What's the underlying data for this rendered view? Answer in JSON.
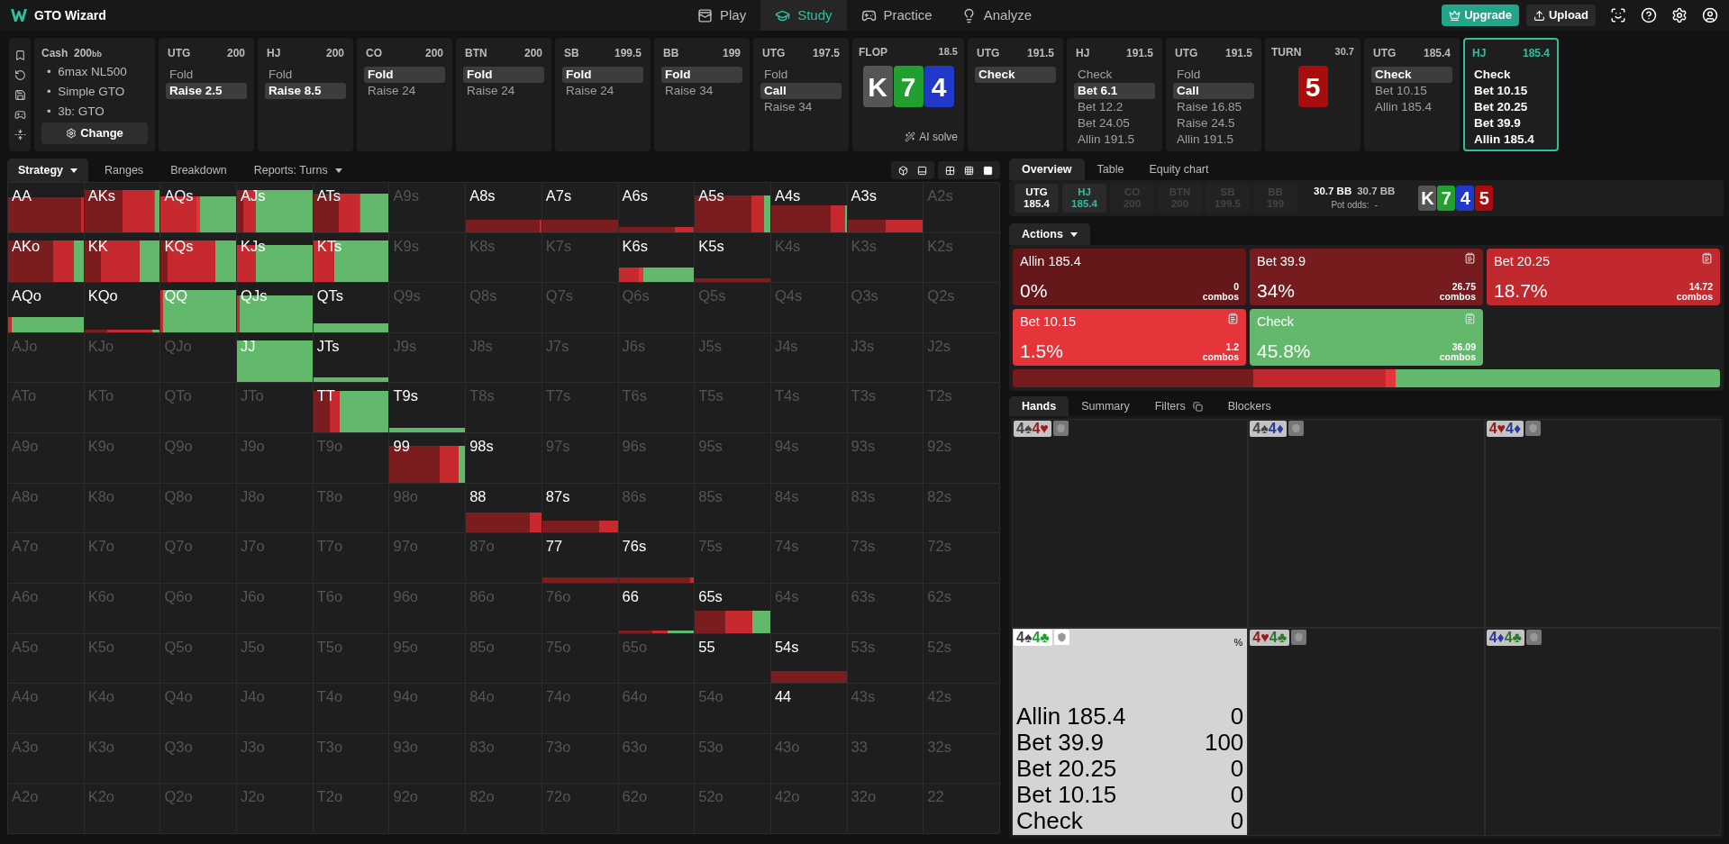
{
  "app": {
    "name": "GTO Wizard"
  },
  "nav": [
    {
      "label": "Play",
      "selected": false
    },
    {
      "label": "Study",
      "selected": true
    },
    {
      "label": "Practice",
      "selected": false
    },
    {
      "label": "Analyze",
      "selected": false
    }
  ],
  "top_buttons": [
    {
      "label": "Upgrade",
      "kind": "primary"
    },
    {
      "label": "Upload",
      "kind": "secondary"
    }
  ],
  "config": {
    "game": "Cash",
    "stack": "200",
    "unit": "bb",
    "bullet": "•",
    "items": [
      "6max NL500",
      "Simple GTO",
      "3b: GTO"
    ],
    "button": "Change"
  },
  "nodes": [
    {
      "kind": "player",
      "position": "UTG",
      "stack": "200",
      "active": false,
      "actions": [
        {
          "label": "Fold",
          "selected": false
        },
        {
          "label": "Raise 2.5",
          "selected": true
        }
      ]
    },
    {
      "kind": "player",
      "position": "HJ",
      "stack": "200",
      "active": false,
      "actions": [
        {
          "label": "Fold",
          "selected": false
        },
        {
          "label": "Raise 8.5",
          "selected": true
        }
      ]
    },
    {
      "kind": "player",
      "position": "CO",
      "stack": "200",
      "active": false,
      "actions": [
        {
          "label": "Fold",
          "selected": true
        },
        {
          "label": "Raise 24",
          "selected": false
        }
      ]
    },
    {
      "kind": "player",
      "position": "BTN",
      "stack": "200",
      "active": false,
      "actions": [
        {
          "label": "Fold",
          "selected": true
        },
        {
          "label": "Raise 24",
          "selected": false
        }
      ]
    },
    {
      "kind": "player",
      "position": "SB",
      "stack": "199.5",
      "active": false,
      "actions": [
        {
          "label": "Fold",
          "selected": true
        },
        {
          "label": "Raise 24",
          "selected": false
        }
      ]
    },
    {
      "kind": "player",
      "position": "BB",
      "stack": "199",
      "active": false,
      "actions": [
        {
          "label": "Fold",
          "selected": true
        },
        {
          "label": "Raise 34",
          "selected": false
        }
      ]
    },
    {
      "kind": "player",
      "position": "UTG",
      "stack": "197.5",
      "active": false,
      "actions": [
        {
          "label": "Fold",
          "selected": false
        },
        {
          "label": "Call",
          "selected": true
        },
        {
          "label": "Raise 34",
          "selected": false
        }
      ]
    },
    {
      "kind": "board",
      "position": "FLOP",
      "stack": "18.5",
      "cards": [
        {
          "rank": "K",
          "color": "#555555"
        },
        {
          "rank": "7",
          "color": "#22a02f"
        },
        {
          "rank": "4",
          "color": "#2238c8"
        }
      ],
      "link": "AI solve"
    },
    {
      "kind": "player",
      "position": "UTG",
      "stack": "191.5",
      "active": false,
      "actions": [
        {
          "label": "Check",
          "selected": true
        }
      ]
    },
    {
      "kind": "player",
      "position": "HJ",
      "stack": "191.5",
      "active": false,
      "actions": [
        {
          "label": "Check",
          "selected": false
        },
        {
          "label": "Bet 6.1",
          "selected": true
        },
        {
          "label": "Bet 12.2",
          "selected": false
        },
        {
          "label": "Bet 24.05",
          "selected": false
        },
        {
          "label": "Allin 191.5",
          "selected": false
        }
      ]
    },
    {
      "kind": "player",
      "position": "UTG",
      "stack": "191.5",
      "active": false,
      "actions": [
        {
          "label": "Fold",
          "selected": false
        },
        {
          "label": "Call",
          "selected": true
        },
        {
          "label": "Raise 16.85",
          "selected": false
        },
        {
          "label": "Raise 24.5",
          "selected": false
        },
        {
          "label": "Allin 191.5",
          "selected": false
        }
      ]
    },
    {
      "kind": "board",
      "position": "TURN",
      "stack": "30.7",
      "cards": [
        {
          "rank": "5",
          "color": "#a80d0d"
        }
      ]
    },
    {
      "kind": "player",
      "position": "UTG",
      "stack": "185.4",
      "active": false,
      "actions": [
        {
          "label": "Check",
          "selected": true
        },
        {
          "label": "Bet 10.15",
          "selected": false
        },
        {
          "label": "Allin 185.4",
          "selected": false
        }
      ]
    },
    {
      "kind": "player",
      "position": "HJ",
      "stack": "185.4",
      "active": true,
      "actions": [
        {
          "label": "Check",
          "selected": false
        },
        {
          "label": "Bet 10.15",
          "selected": false
        },
        {
          "label": "Bet 20.25",
          "selected": false
        },
        {
          "label": "Bet 39.9",
          "selected": false
        },
        {
          "label": "Allin 185.4",
          "selected": false
        }
      ]
    }
  ],
  "matrix": {
    "tabs": [
      {
        "label": "Strategy",
        "selected": true,
        "dropdown": true
      },
      {
        "label": "Ranges",
        "selected": false,
        "dropdown": false
      },
      {
        "label": "Breakdown",
        "selected": false,
        "dropdown": false
      },
      {
        "label": "Reports: Turns",
        "selected": false,
        "dropdown": true
      }
    ],
    "rows": [
      [
        {
          "label": "AA",
          "active": true
        },
        {
          "label": "AKs",
          "active": true
        },
        {
          "label": "AQs",
          "active": true
        },
        {
          "label": "AJs",
          "active": true
        },
        {
          "label": "ATs",
          "active": true
        },
        {
          "label": "A9s",
          "active": false
        },
        {
          "label": "A8s",
          "active": true
        },
        {
          "label": "A7s",
          "active": true
        },
        {
          "label": "A6s",
          "active": true
        },
        {
          "label": "A5s",
          "active": true
        },
        {
          "label": "A4s",
          "active": true
        },
        {
          "label": "A3s",
          "active": true
        },
        {
          "label": "A2s",
          "active": false
        }
      ],
      [
        {
          "label": "AKo",
          "active": true
        },
        {
          "label": "KK",
          "active": true
        },
        {
          "label": "KQs",
          "active": true
        },
        {
          "label": "KJs",
          "active": true
        },
        {
          "label": "KTs",
          "active": true
        },
        {
          "label": "K9s",
          "active": false
        },
        {
          "label": "K8s",
          "active": false
        },
        {
          "label": "K7s",
          "active": false
        },
        {
          "label": "K6s",
          "active": true
        },
        {
          "label": "K5s",
          "active": true
        },
        {
          "label": "K4s",
          "active": false
        },
        {
          "label": "K3s",
          "active": false
        },
        {
          "label": "K2s",
          "active": false
        }
      ],
      [
        {
          "label": "AQo",
          "active": true
        },
        {
          "label": "KQo",
          "active": true
        },
        {
          "label": "QQ",
          "active": true
        },
        {
          "label": "QJs",
          "active": true
        },
        {
          "label": "QTs",
          "active": true
        },
        {
          "label": "Q9s",
          "active": false
        },
        {
          "label": "Q8s",
          "active": false
        },
        {
          "label": "Q7s",
          "active": false
        },
        {
          "label": "Q6s",
          "active": false
        },
        {
          "label": "Q5s",
          "active": false
        },
        {
          "label": "Q4s",
          "active": false
        },
        {
          "label": "Q3s",
          "active": false
        },
        {
          "label": "Q2s",
          "active": false
        }
      ],
      [
        {
          "label": "AJo",
          "active": false
        },
        {
          "label": "KJo",
          "active": false
        },
        {
          "label": "QJo",
          "active": false
        },
        {
          "label": "JJ",
          "active": true
        },
        {
          "label": "JTs",
          "active": true
        },
        {
          "label": "J9s",
          "active": false
        },
        {
          "label": "J8s",
          "active": false
        },
        {
          "label": "J7s",
          "active": false
        },
        {
          "label": "J6s",
          "active": false
        },
        {
          "label": "J5s",
          "active": false
        },
        {
          "label": "J4s",
          "active": false
        },
        {
          "label": "J3s",
          "active": false
        },
        {
          "label": "J2s",
          "active": false
        }
      ],
      [
        {
          "label": "ATo",
          "active": false
        },
        {
          "label": "KTo",
          "active": false
        },
        {
          "label": "QTo",
          "active": false
        },
        {
          "label": "JTo",
          "active": false
        },
        {
          "label": "TT",
          "active": true
        },
        {
          "label": "T9s",
          "active": true
        },
        {
          "label": "T8s",
          "active": false
        },
        {
          "label": "T7s",
          "active": false
        },
        {
          "label": "T6s",
          "active": false
        },
        {
          "label": "T5s",
          "active": false
        },
        {
          "label": "T4s",
          "active": false
        },
        {
          "label": "T3s",
          "active": false
        },
        {
          "label": "T2s",
          "active": false
        }
      ],
      [
        {
          "label": "A9o",
          "active": false
        },
        {
          "label": "K9o",
          "active": false
        },
        {
          "label": "Q9o",
          "active": false
        },
        {
          "label": "J9o",
          "active": false
        },
        {
          "label": "T9o",
          "active": false
        },
        {
          "label": "99",
          "active": true
        },
        {
          "label": "98s",
          "active": true
        },
        {
          "label": "97s",
          "active": false
        },
        {
          "label": "96s",
          "active": false
        },
        {
          "label": "95s",
          "active": false
        },
        {
          "label": "94s",
          "active": false
        },
        {
          "label": "93s",
          "active": false
        },
        {
          "label": "92s",
          "active": false
        }
      ],
      [
        {
          "label": "A8o",
          "active": false
        },
        {
          "label": "K8o",
          "active": false
        },
        {
          "label": "Q8o",
          "active": false
        },
        {
          "label": "J8o",
          "active": false
        },
        {
          "label": "T8o",
          "active": false
        },
        {
          "label": "98o",
          "active": false
        },
        {
          "label": "88",
          "active": true
        },
        {
          "label": "87s",
          "active": true
        },
        {
          "label": "86s",
          "active": false
        },
        {
          "label": "85s",
          "active": false
        },
        {
          "label": "84s",
          "active": false
        },
        {
          "label": "83s",
          "active": false
        },
        {
          "label": "82s",
          "active": false
        }
      ],
      [
        {
          "label": "A7o",
          "active": false
        },
        {
          "label": "K7o",
          "active": false
        },
        {
          "label": "Q7o",
          "active": false
        },
        {
          "label": "J7o",
          "active": false
        },
        {
          "label": "T7o",
          "active": false
        },
        {
          "label": "97o",
          "active": false
        },
        {
          "label": "87o",
          "active": false
        },
        {
          "label": "77",
          "active": true
        },
        {
          "label": "76s",
          "active": true
        },
        {
          "label": "75s",
          "active": false
        },
        {
          "label": "74s",
          "active": false
        },
        {
          "label": "73s",
          "active": false
        },
        {
          "label": "72s",
          "active": false
        }
      ],
      [
        {
          "label": "A6o",
          "active": false
        },
        {
          "label": "K6o",
          "active": false
        },
        {
          "label": "Q6o",
          "active": false
        },
        {
          "label": "J6o",
          "active": false
        },
        {
          "label": "T6o",
          "active": false
        },
        {
          "label": "96o",
          "active": false
        },
        {
          "label": "86o",
          "active": false
        },
        {
          "label": "76o",
          "active": false
        },
        {
          "label": "66",
          "active": true
        },
        {
          "label": "65s",
          "active": true
        },
        {
          "label": "64s",
          "active": false
        },
        {
          "label": "63s",
          "active": false
        },
        {
          "label": "62s",
          "active": false
        }
      ],
      [
        {
          "label": "A5o",
          "active": false
        },
        {
          "label": "K5o",
          "active": false
        },
        {
          "label": "Q5o",
          "active": false
        },
        {
          "label": "J5o",
          "active": false
        },
        {
          "label": "T5o",
          "active": false
        },
        {
          "label": "95o",
          "active": false
        },
        {
          "label": "85o",
          "active": false
        },
        {
          "label": "75o",
          "active": false
        },
        {
          "label": "65o",
          "active": false
        },
        {
          "label": "55",
          "active": true
        },
        {
          "label": "54s",
          "active": true
        },
        {
          "label": "53s",
          "active": false
        },
        {
          "label": "52s",
          "active": false
        }
      ],
      [
        {
          "label": "A4o",
          "active": false
        },
        {
          "label": "K4o",
          "active": false
        },
        {
          "label": "Q4o",
          "active": false
        },
        {
          "label": "J4o",
          "active": false
        },
        {
          "label": "T4o",
          "active": false
        },
        {
          "label": "94o",
          "active": false
        },
        {
          "label": "84o",
          "active": false
        },
        {
          "label": "74o",
          "active": false
        },
        {
          "label": "64o",
          "active": false
        },
        {
          "label": "54o",
          "active": false
        },
        {
          "label": "44",
          "active": true
        },
        {
          "label": "43s",
          "active": false
        },
        {
          "label": "42s",
          "active": false
        }
      ],
      [
        {
          "label": "A3o",
          "active": false
        },
        {
          "label": "K3o",
          "active": false
        },
        {
          "label": "Q3o",
          "active": false
        },
        {
          "label": "J3o",
          "active": false
        },
        {
          "label": "T3o",
          "active": false
        },
        {
          "label": "93o",
          "active": false
        },
        {
          "label": "83o",
          "active": false
        },
        {
          "label": "73o",
          "active": false
        },
        {
          "label": "63o",
          "active": false
        },
        {
          "label": "53o",
          "active": false
        },
        {
          "label": "43o",
          "active": false
        },
        {
          "label": "33",
          "active": false
        },
        {
          "label": "32s",
          "active": false
        }
      ],
      [
        {
          "label": "A2o",
          "active": false
        },
        {
          "label": "K2o",
          "active": false
        },
        {
          "label": "Q2o",
          "active": false
        },
        {
          "label": "J2o",
          "active": false
        },
        {
          "label": "T2o",
          "active": false
        },
        {
          "label": "92o",
          "active": false
        },
        {
          "label": "82o",
          "active": false
        },
        {
          "label": "72o",
          "active": false
        },
        {
          "label": "62o",
          "active": false
        },
        {
          "label": "52o",
          "active": false
        },
        {
          "label": "42o",
          "active": false
        },
        {
          "label": "32o",
          "active": false
        },
        {
          "label": "22",
          "active": false
        }
      ]
    ]
  },
  "overview": {
    "tabs": [
      {
        "label": "Overview",
        "selected": true
      },
      {
        "label": "Table",
        "selected": false
      },
      {
        "label": "Equity chart",
        "selected": false
      }
    ],
    "players": [
      {
        "position": "UTG",
        "stack": "185.4",
        "kind": "active"
      },
      {
        "position": "HJ",
        "stack": "185.4",
        "kind": "current"
      },
      {
        "position": "CO",
        "stack": "200",
        "kind": "folded"
      },
      {
        "position": "BTN",
        "stack": "200",
        "kind": "folded"
      },
      {
        "position": "SB",
        "stack": "199.5",
        "kind": "folded"
      },
      {
        "position": "BB",
        "stack": "199",
        "kind": "folded"
      }
    ],
    "pot": {
      "main": "30.7 BB",
      "total": "30.7 BB",
      "odds_label": "Pot odds:",
      "odds": "-"
    },
    "board": [
      {
        "rank": "K",
        "color": "#555555"
      },
      {
        "rank": "7",
        "color": "#22a02f"
      },
      {
        "rank": "4",
        "color": "#2238c8"
      },
      {
        "rank": "5",
        "color": "#a80d0d"
      }
    ],
    "actions_menu": "Actions",
    "actions": [
      {
        "label": "Allin 185.4",
        "percent": "0%",
        "combos": "0",
        "unit": "combos",
        "color": "#65171a",
        "notes": false
      },
      {
        "label": "Bet 39.9",
        "percent": "34%",
        "combos": "26.75",
        "unit": "combos",
        "color": "#761b1e",
        "notes": true
      },
      {
        "label": "Bet 20.25",
        "percent": "18.7%",
        "combos": "14.72",
        "unit": "combos",
        "color": "#c1292e",
        "notes": true
      },
      {
        "label": "Bet 10.15",
        "percent": "1.5%",
        "combos": "1.2",
        "unit": "combos",
        "color": "#e5343a",
        "notes": true
      },
      {
        "label": "Check",
        "percent": "45.8%",
        "combos": "36.09",
        "unit": "combos",
        "color": "#62b96b",
        "notes": true
      }
    ]
  },
  "hands": {
    "tabs": [
      {
        "label": "Hands",
        "selected": true,
        "icon": false
      },
      {
        "label": "Summary",
        "selected": false,
        "icon": false
      },
      {
        "label": "Filters",
        "selected": false,
        "icon": true
      },
      {
        "label": "Blockers",
        "selected": false,
        "icon": false
      }
    ],
    "items": [
      {
        "selected": false,
        "cards": [
          {
            "text": "4♠",
            "color": "#444444"
          },
          {
            "text": "4♥",
            "color": "#9b1b1b"
          }
        ]
      },
      {
        "selected": false,
        "cards": [
          {
            "text": "4♠",
            "color": "#444444"
          },
          {
            "text": "4♦",
            "color": "#2a3aa0"
          }
        ]
      },
      {
        "selected": false,
        "cards": [
          {
            "text": "4♥",
            "color": "#9b1b1b"
          },
          {
            "text": "4♦",
            "color": "#2a3aa0"
          }
        ]
      },
      {
        "selected": true,
        "unit": "%",
        "cards": [
          {
            "text": "4♠",
            "color": "#444444"
          },
          {
            "text": "4♣",
            "color": "#1fa030"
          }
        ],
        "rows": [
          {
            "label": "Allin 185.4",
            "value": "0"
          },
          {
            "label": "Bet 39.9",
            "value": "100"
          },
          {
            "label": "Bet 20.25",
            "value": "0"
          },
          {
            "label": "Bet 10.15",
            "value": "0"
          },
          {
            "label": "Check",
            "value": "0"
          }
        ]
      },
      {
        "selected": false,
        "cards": [
          {
            "text": "4♥",
            "color": "#9b1b1b"
          },
          {
            "text": "4♣",
            "color": "#2a7a2a"
          }
        ]
      },
      {
        "selected": false,
        "cards": [
          {
            "text": "4♦",
            "color": "#2a3aa0"
          },
          {
            "text": "4♣",
            "color": "#2a7a2a"
          }
        ]
      }
    ]
  }
}
